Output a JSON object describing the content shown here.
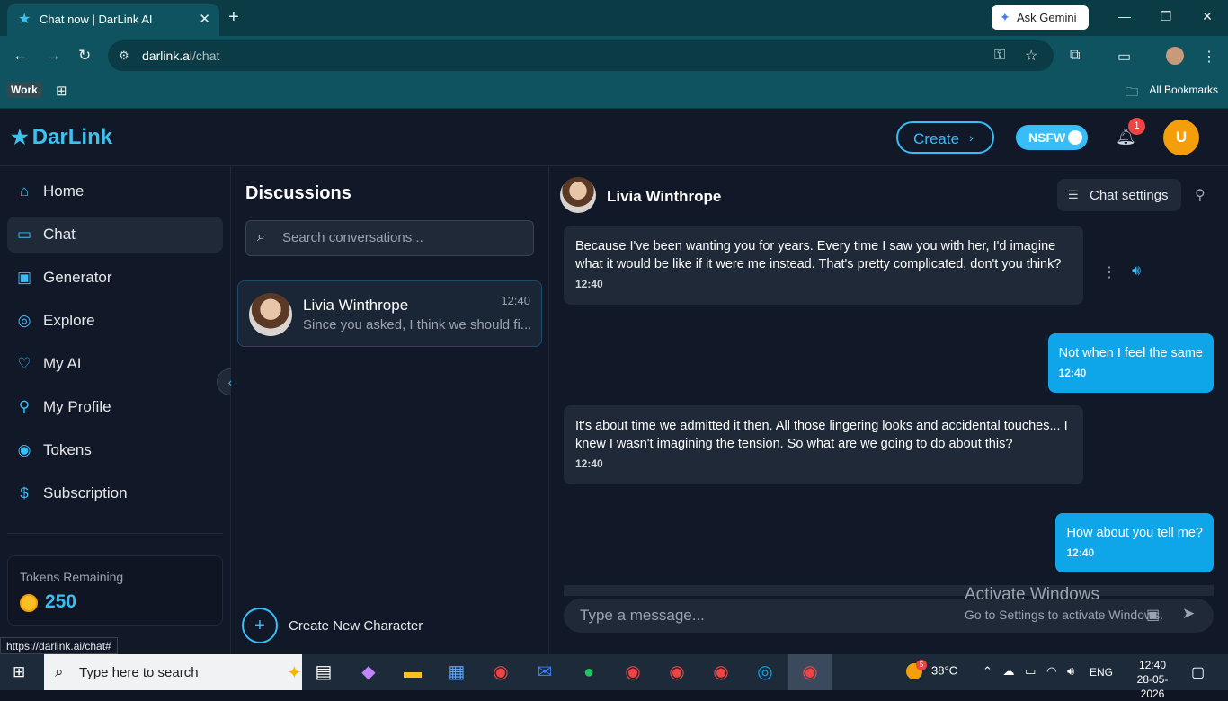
{
  "browser": {
    "tab_title": "Chat now | DarLink AI",
    "tab_close": "✕",
    "new_tab": "+",
    "gemini_label": "Ask Gemini",
    "url_domain": "darlink.ai",
    "url_path": "/chat",
    "bookmark_work": "Work",
    "all_bookmarks": "All Bookmarks",
    "status_url": "https://darlink.ai/chat#"
  },
  "app": {
    "logo": "DarLink",
    "create_label": "Create",
    "nsfw_label": "NSFW",
    "notification_count": "1",
    "user_initial": "U",
    "accent_color": "#38bdf8"
  },
  "sidebar": {
    "items": [
      {
        "label": "Home",
        "icon": "home-icon"
      },
      {
        "label": "Chat",
        "icon": "chat-icon"
      },
      {
        "label": "Generator",
        "icon": "image-icon"
      },
      {
        "label": "Explore",
        "icon": "compass-icon"
      },
      {
        "label": "My AI",
        "icon": "heart-icon"
      },
      {
        "label": "My Profile",
        "icon": "user-icon"
      },
      {
        "label": "Tokens",
        "icon": "coins-icon"
      },
      {
        "label": "Subscription",
        "icon": "dollar-icon"
      }
    ],
    "tokens_label": "Tokens Remaining",
    "tokens_value": "250"
  },
  "discussions": {
    "title": "Discussions",
    "search_placeholder": "Search conversations...",
    "conversations": [
      {
        "name": "Livia Winthrope",
        "time": "12:40",
        "preview": "Since you asked, I think we should fi..."
      }
    ],
    "create_character": "Create New Character"
  },
  "chat": {
    "character_name": "Livia Winthrope",
    "settings_label": "Chat settings",
    "messages": [
      {
        "from": "ai",
        "text": "Because I've been wanting you for years. Every time I saw you with her, I'd imagine what it would be like if it were me instead. That's pretty complicated, don't you think?",
        "time": "12:40"
      },
      {
        "from": "me",
        "text": "Not when I feel the same",
        "time": "12:40"
      },
      {
        "from": "ai",
        "text": "It's about time we admitted it then. All those lingering looks and accidental touches... I knew I wasn't imagining the tension. So what are we going to do about this?",
        "time": "12:40"
      },
      {
        "from": "me",
        "text": "How about you tell me?",
        "time": "12:40"
      }
    ],
    "input_placeholder": "Type a message..."
  },
  "watermark": {
    "line1": "Activate Windows",
    "line2": "Go to Settings to activate Windows."
  },
  "taskbar": {
    "search_label": "Type here to search",
    "weather": "38°C",
    "weather_badge": "5",
    "language": "ENG",
    "time": "12:40",
    "date": "28-05-2026"
  }
}
